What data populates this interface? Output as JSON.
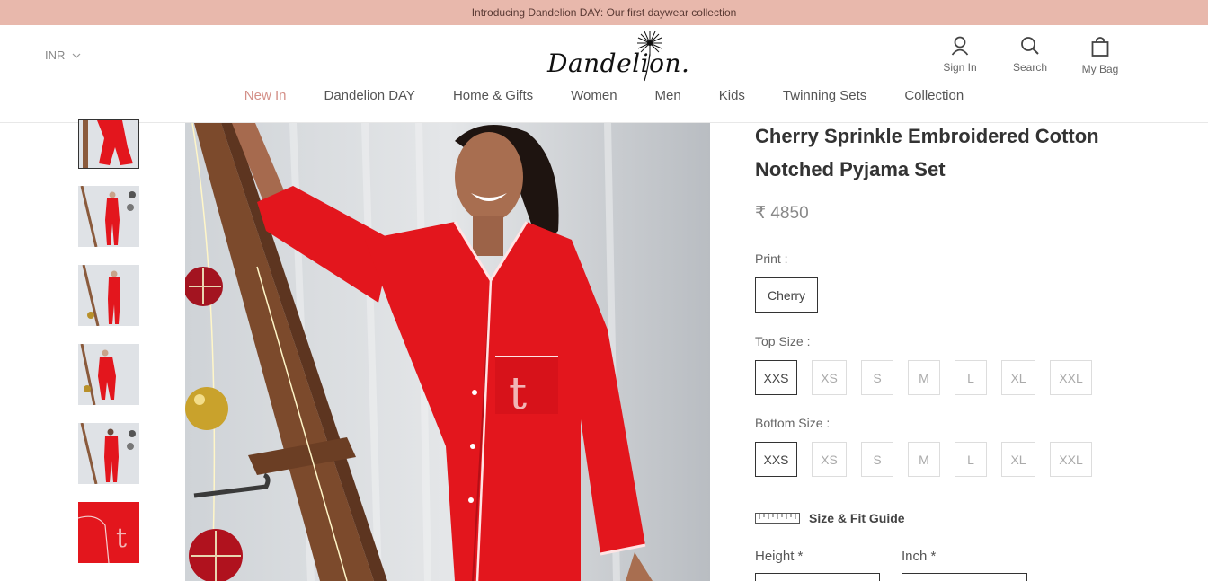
{
  "announcement": "Introducing Dandelion DAY: Our first daywear collection",
  "header": {
    "currency": "INR",
    "logo_text": "Dandelion.",
    "icons": {
      "sign_in": "Sign In",
      "search": "Search",
      "bag": "My Bag"
    }
  },
  "nav": [
    "New In",
    "Dandelion DAY",
    "Home & Gifts",
    "Women",
    "Men",
    "Kids",
    "Twinning Sets",
    "Collection"
  ],
  "product": {
    "title_line1": "Cherry Sprinkle Embroidered Cotton",
    "title_line2": "Notched Pyjama Set",
    "price": "₹ 4850",
    "print_label": "Print :",
    "print_value": "Cherry",
    "top_size_label": "Top Size :",
    "bottom_size_label": "Bottom Size :",
    "sizes": [
      "XXS",
      "XS",
      "S",
      "M",
      "L",
      "XL",
      "XXL"
    ],
    "selected_size": "XXS",
    "size_guide": "Size & Fit Guide",
    "height_label": "Height *",
    "inch_label": "Inch *"
  },
  "colors": {
    "accent": "#d49088",
    "banner": "#e8b8ac",
    "pyjama_red": "#e3161d"
  }
}
